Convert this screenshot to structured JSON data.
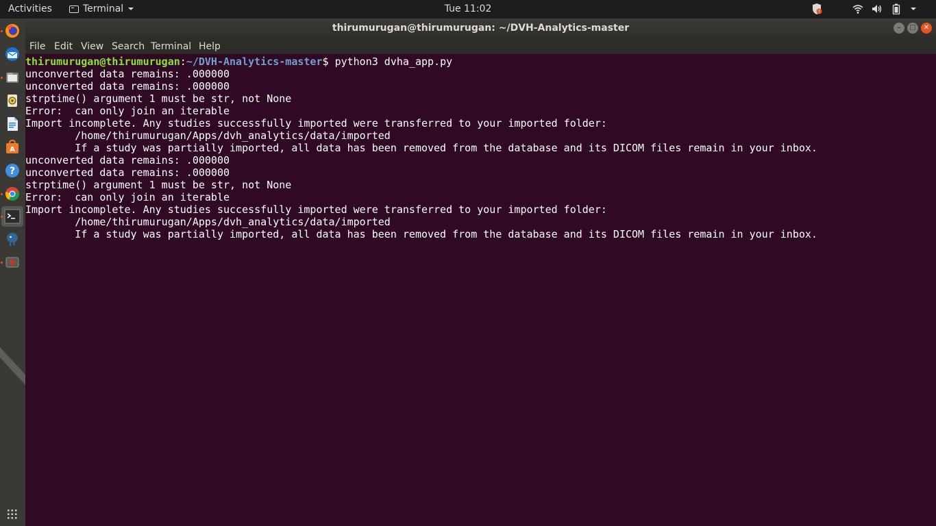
{
  "topbar": {
    "activities": "Activities",
    "app_menu": "Terminal",
    "clock": "Tue 11:02"
  },
  "window": {
    "title": "thirumurugan@thirumurugan: ~/DVH-Analytics-master",
    "minimize": "–",
    "maximize": "□",
    "close": "✕"
  },
  "menubar": {
    "file": "File",
    "edit": "Edit",
    "view": "View",
    "search": "Search",
    "terminal": "Terminal",
    "help": "Help"
  },
  "terminal": {
    "prompt_user": "thirumurugan@thirumurugan",
    "prompt_sep": ":",
    "prompt_path": "~/DVH-Analytics-master",
    "prompt_symbol": "$ ",
    "command": "python3 dvha_app.py",
    "lines": [
      "unconverted data remains: .000000",
      "unconverted data remains: .000000",
      "strptime() argument 1 must be str, not None",
      "Error:  can only join an iterable",
      "Import incomplete. Any studies successfully imported were transferred to your imported folder:",
      "        /home/thirumurugan/Apps/dvh_analytics/data/imported",
      "        If a study was partially imported, all data has been removed from the database and its DICOM files remain in your inbox.",
      "unconverted data remains: .000000",
      "unconverted data remains: .000000",
      "strptime() argument 1 must be str, not None",
      "Error:  can only join an iterable",
      "Import incomplete. Any studies successfully imported were transferred to your imported folder:",
      "        /home/thirumurugan/Apps/dvh_analytics/data/imported",
      "        If a study was partially imported, all data has been removed from the database and its DICOM files remain in your inbox."
    ]
  },
  "dock": {
    "items": [
      "firefox-icon",
      "thunderbird-icon",
      "files-icon",
      "rhythmbox-icon",
      "writer-icon",
      "software-center-icon",
      "help-icon",
      "chrome-icon",
      "terminal-icon",
      "postgres-icon",
      "media-icon"
    ]
  },
  "colors": {
    "terminal_bg": "#300a24",
    "prompt_user": "#8ae234",
    "prompt_path": "#729fcf",
    "accent": "#e95420"
  }
}
